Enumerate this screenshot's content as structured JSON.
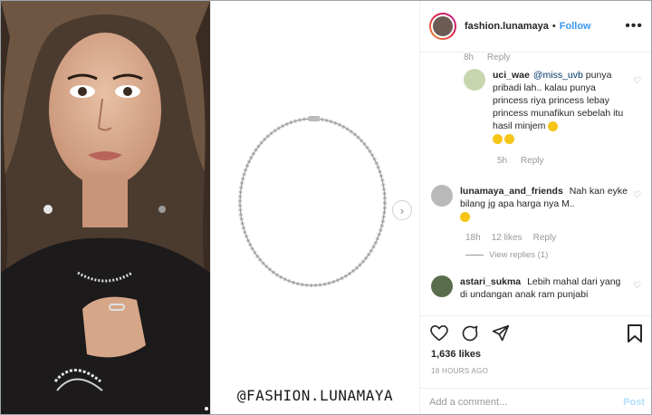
{
  "post": {
    "watermark": "@FASHION.LUNAMAYA",
    "next_arrow": "›"
  },
  "header": {
    "username": "fashion.lunamaya",
    "separator": "•",
    "follow_label": "Follow",
    "more_label": "•••"
  },
  "comments": {
    "first_meta": {
      "time": "8h",
      "reply": "Reply"
    },
    "c1": {
      "user": "uci_wae",
      "mention": "@miss_uvb",
      "text": "punya pribadi lah.. kalau punya princess riya princess lebay princess munafikun sebelah itu hasil minjem",
      "time": "5h",
      "reply": "Reply"
    },
    "c2": {
      "user": "lunamaya_and_friends",
      "text": "Nah kan eyke bilang jg apa harga nya M..",
      "time": "18h",
      "likes": "12 likes",
      "reply": "Reply",
      "view_replies": "View replies (1)"
    },
    "c3": {
      "user": "astari_sukma",
      "text": "Lebih mahal dari yang di undangan anak ram punjabi"
    }
  },
  "actions": {
    "likes": "1,636 likes",
    "timestamp": "18 HOURS AGO"
  },
  "comment_box": {
    "placeholder": "Add a comment...",
    "post_label": "Post"
  },
  "colors": {
    "accent": "#3897f0",
    "post_disabled": "#b2dffc",
    "muted": "#999999"
  }
}
